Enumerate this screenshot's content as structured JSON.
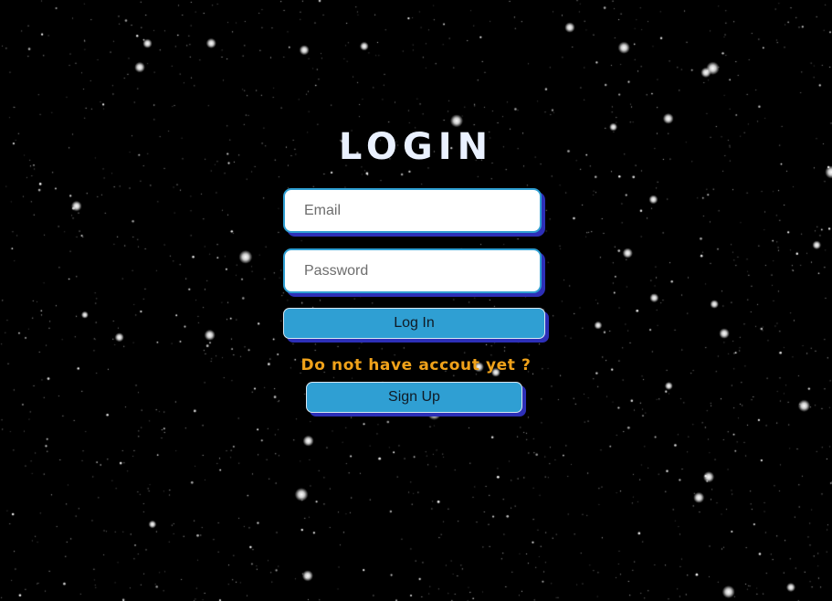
{
  "page": {
    "title": "LOGIN"
  },
  "form": {
    "email_placeholder": "Email",
    "email_value": "",
    "password_placeholder": "Password",
    "password_value": "",
    "login_label": "Log In",
    "signup_prompt": "Do not have accout yet ?",
    "signup_label": "Sign Up"
  },
  "theme": {
    "background": "#000000",
    "accent": "#2f9fd3",
    "shadow": "#2d2fb8",
    "prompt_color": "#f0a21a",
    "title_color": "#eaf1ff"
  }
}
